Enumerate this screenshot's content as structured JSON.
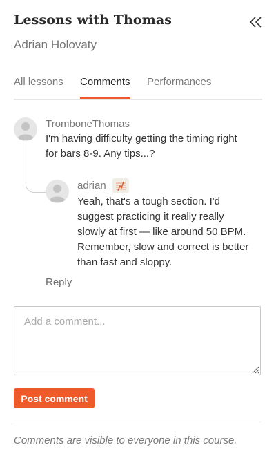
{
  "header": {
    "title": "Lessons with Thomas",
    "subtitle": "Adrian Holovaty",
    "collapse_icon": "double-chevron-left-icon"
  },
  "tabs": [
    {
      "label": "All lessons",
      "active": false
    },
    {
      "label": "Comments",
      "active": true
    },
    {
      "label": "Performances",
      "active": false
    }
  ],
  "accent_color": "#ef5a2b",
  "thread": {
    "comment": {
      "author": "TromboneThomas",
      "text_lines": [
        "I'm having difficulty getting the timing right",
        "for bars 8-9. Any tips...?"
      ]
    },
    "reply": {
      "author": "adrian",
      "badge_icon": "score-chart-icon",
      "text_lines": [
        "Yeah, that's a tough section. I'd",
        "suggest practicing it really really",
        "slowly at first — like around 50 BPM.",
        "Remember, slow and correct is better",
        "than fast and sloppy."
      ]
    },
    "reply_label": "Reply"
  },
  "compose": {
    "placeholder": "Add a comment...",
    "value": "",
    "submit_label": "Post comment"
  },
  "footer_note": "Comments are visible to everyone in this course."
}
